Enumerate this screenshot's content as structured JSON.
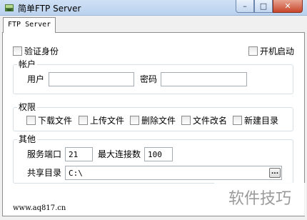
{
  "window": {
    "title": "简单FTP Server",
    "minimize_glyph": "–",
    "maximize_glyph": "□",
    "close_glyph": "✕"
  },
  "tab": {
    "label": "FTP Server"
  },
  "auth": {
    "verify_identity_label": "验证身份",
    "autostart_label": "开机启动"
  },
  "account": {
    "group_label": "帐户",
    "user_label": "用户",
    "user_value": "",
    "password_label": "密码",
    "password_value": ""
  },
  "permissions": {
    "group_label": "权限",
    "items": [
      {
        "label": "下载文件"
      },
      {
        "label": "上传文件"
      },
      {
        "label": "删除文件"
      },
      {
        "label": "文件改名"
      },
      {
        "label": "新建目录"
      }
    ]
  },
  "other": {
    "group_label": "其他",
    "port_label": "服务端口",
    "port_value": "21",
    "max_conn_label": "最大连接数",
    "max_conn_value": "100",
    "share_dir_label": "共享目录",
    "share_dir_value": "C:\\",
    "browse_label": "..."
  },
  "footer": {
    "url": "www.aq817.cn"
  },
  "watermark": {
    "text": "软件技巧"
  }
}
